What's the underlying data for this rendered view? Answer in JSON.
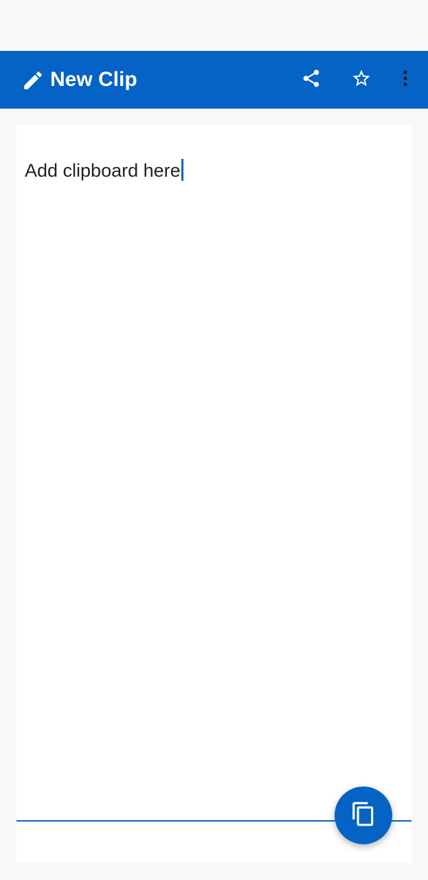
{
  "app_bar": {
    "title": "New Clip",
    "leading_icon": "pencil-icon",
    "actions": [
      {
        "name": "share",
        "icon": "share-icon"
      },
      {
        "name": "favorite",
        "icon": "star-outline-icon"
      },
      {
        "name": "more",
        "icon": "more-vert-icon"
      }
    ]
  },
  "editor": {
    "text": "Add clipboard here"
  },
  "fab": {
    "icon": "copy-icon"
  },
  "colors": {
    "primary": "#0563c5",
    "background": "#f8f8f8",
    "surface": "#ffffff",
    "text": "#222222"
  }
}
